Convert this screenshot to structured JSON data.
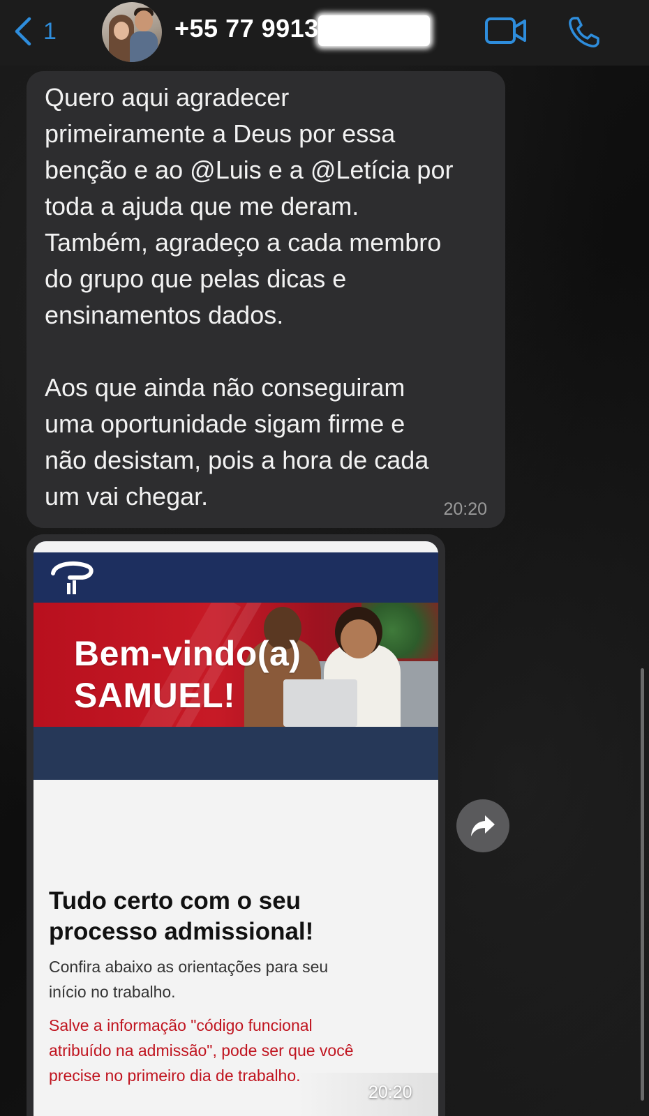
{
  "header": {
    "back_label": "1",
    "contact_name": "+55 77 9913",
    "accent_color": "#2e8ddc"
  },
  "messages": [
    {
      "type": "text",
      "body": "Quero aqui agradecer\nprimeiramente a Deus por essa\nbenção e ao @Luis e a @Letícia por\ntoda a ajuda que me deram.\nTambém, agradeço a cada membro\ndo grupo que pelas dicas e\nensinamentos dados.\n\nAos que ainda não conseguiram\numa oportunidade sigam firme e\nnão desistam, pois a hora de cada\num vai chegar.",
      "time": "20:20"
    },
    {
      "type": "image",
      "banner_line1": "Bem-vindo(a)",
      "banner_line2": "SAMUEL!",
      "heading": "Tudo certo com o seu\nprocesso admissional!",
      "subtext": "Confira abaixo as orientações para seu\ninício no trabalho.",
      "warning": "Salve a informação \"código funcional\natribuído na admissão\", pode ser que você\nprecise no primeiro dia de trabalho.",
      "time": "20:20"
    }
  ],
  "icons": {
    "back": "chevron-left-icon",
    "video": "video-camera-icon",
    "call": "phone-icon",
    "forward": "forward-arrow-icon"
  }
}
